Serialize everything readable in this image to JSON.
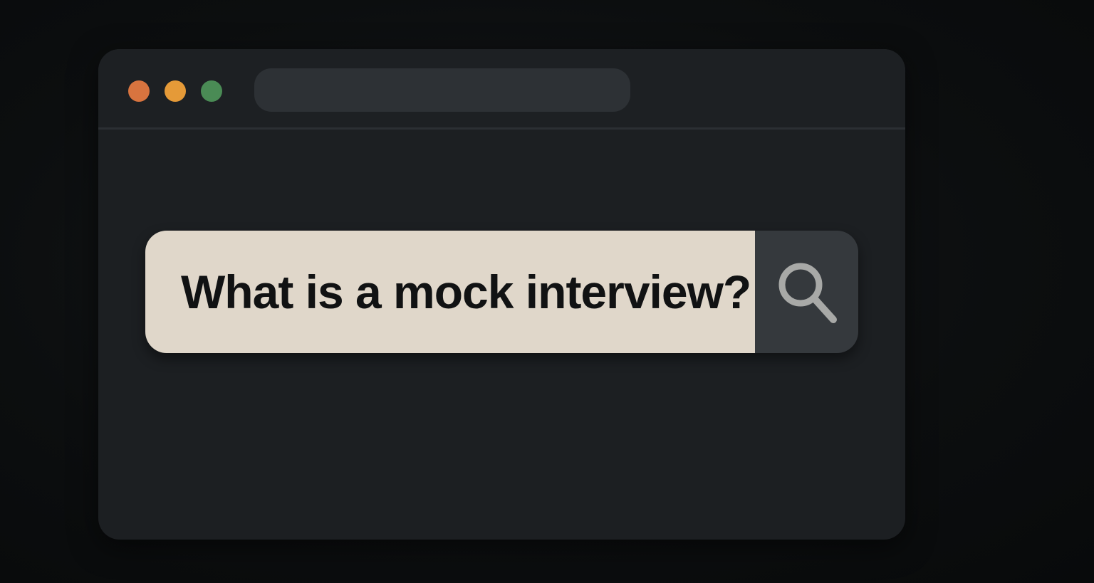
{
  "colors": {
    "close_dot": "#d8743f",
    "minimize_dot": "#e59a38",
    "maximize_dot": "#4a8b55",
    "search_icon": "#a8a9a7"
  },
  "search": {
    "query": "What is a mock interview?",
    "button_icon": "search-icon"
  }
}
